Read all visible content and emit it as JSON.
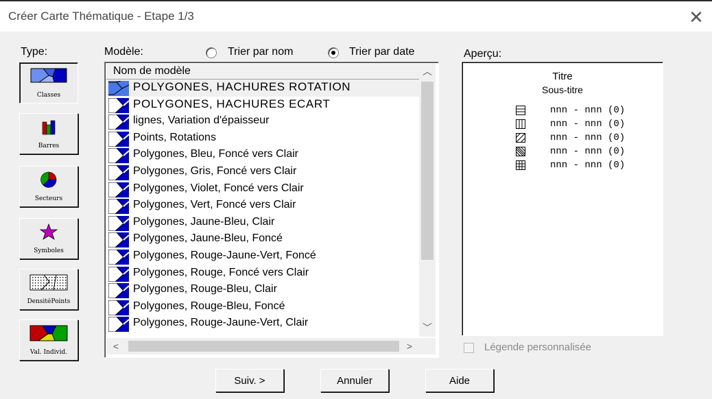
{
  "window": {
    "title": "Créer Carte Thématique - Etape 1/3",
    "close_glyph": "✕"
  },
  "type_label": "Type:",
  "model_label": "Modèle:",
  "sort": {
    "by_name": "Trier par nom",
    "by_date": "Trier par date",
    "selected": "by_date"
  },
  "types": [
    {
      "label": "Classes",
      "icon": "classes-map-icon",
      "pressed": true
    },
    {
      "label": "Barres",
      "icon": "bar-chart-icon",
      "pressed": false
    },
    {
      "label": "Secteurs",
      "icon": "pie-chart-icon",
      "pressed": false
    },
    {
      "label": "Symboles",
      "icon": "star-symbol-icon",
      "pressed": false
    },
    {
      "label": "DensitéPoints",
      "icon": "dot-density-icon",
      "pressed": false
    },
    {
      "label": "Val. Individ.",
      "icon": "individual-values-map-icon",
      "pressed": false
    }
  ],
  "list": {
    "header": "Nom de modèle",
    "selected_index": 0,
    "items": [
      "POLYGONES, HACHURES ROTATION",
      "POLYGONES, HACHURES ECART",
      "lignes, Variation d'épaisseur",
      "Points, Rotations",
      "Polygones, Bleu, Foncé vers Clair",
      "Polygones, Gris, Foncé vers Clair",
      "Polygones, Violet, Foncé vers Clair",
      "Polygones, Vert, Foncé vers Clair",
      "Polygones, Jaune-Bleu, Clair",
      "Polygones, Jaune-Bleu, Foncé",
      "Polygones, Rouge-Jaune-Vert, Foncé",
      "Polygones, Rouge, Foncé vers Clair",
      "Polygones, Rouge-Bleu, Clair",
      "Polygones, Rouge-Bleu, Foncé",
      "Polygones, Rouge-Jaune-Vert, Clair"
    ],
    "scroll_up": "︿",
    "scroll_down": "﹀",
    "scroll_left": "<",
    "scroll_right": ">"
  },
  "preview": {
    "label": "Aperçu:",
    "title": "Titre",
    "subtitle": "Sous-titre",
    "legend": [
      {
        "range": "nnn - nnn",
        "count": "(0)",
        "pattern": "horizontal-lines-icon"
      },
      {
        "range": "nnn - nnn",
        "count": "(0)",
        "pattern": "vertical-lines-icon"
      },
      {
        "range": "nnn - nnn",
        "count": "(0)",
        "pattern": "diagonal-lines-icon"
      },
      {
        "range": "nnn - nnn",
        "count": "(0)",
        "pattern": "back-diagonal-lines-icon"
      },
      {
        "range": "nnn - nnn",
        "count": "(0)",
        "pattern": "grid-icon"
      }
    ]
  },
  "custom_legend": {
    "label": "Légende personnalisée",
    "checked": false,
    "enabled": false
  },
  "buttons": {
    "next": "Suiv. >",
    "cancel": "Annuler",
    "help": "Aide"
  },
  "colors": {
    "list_icon_blue": "#0000c0",
    "selected_row": "#f0f0f0",
    "window_bg": "#f0f0f0"
  }
}
